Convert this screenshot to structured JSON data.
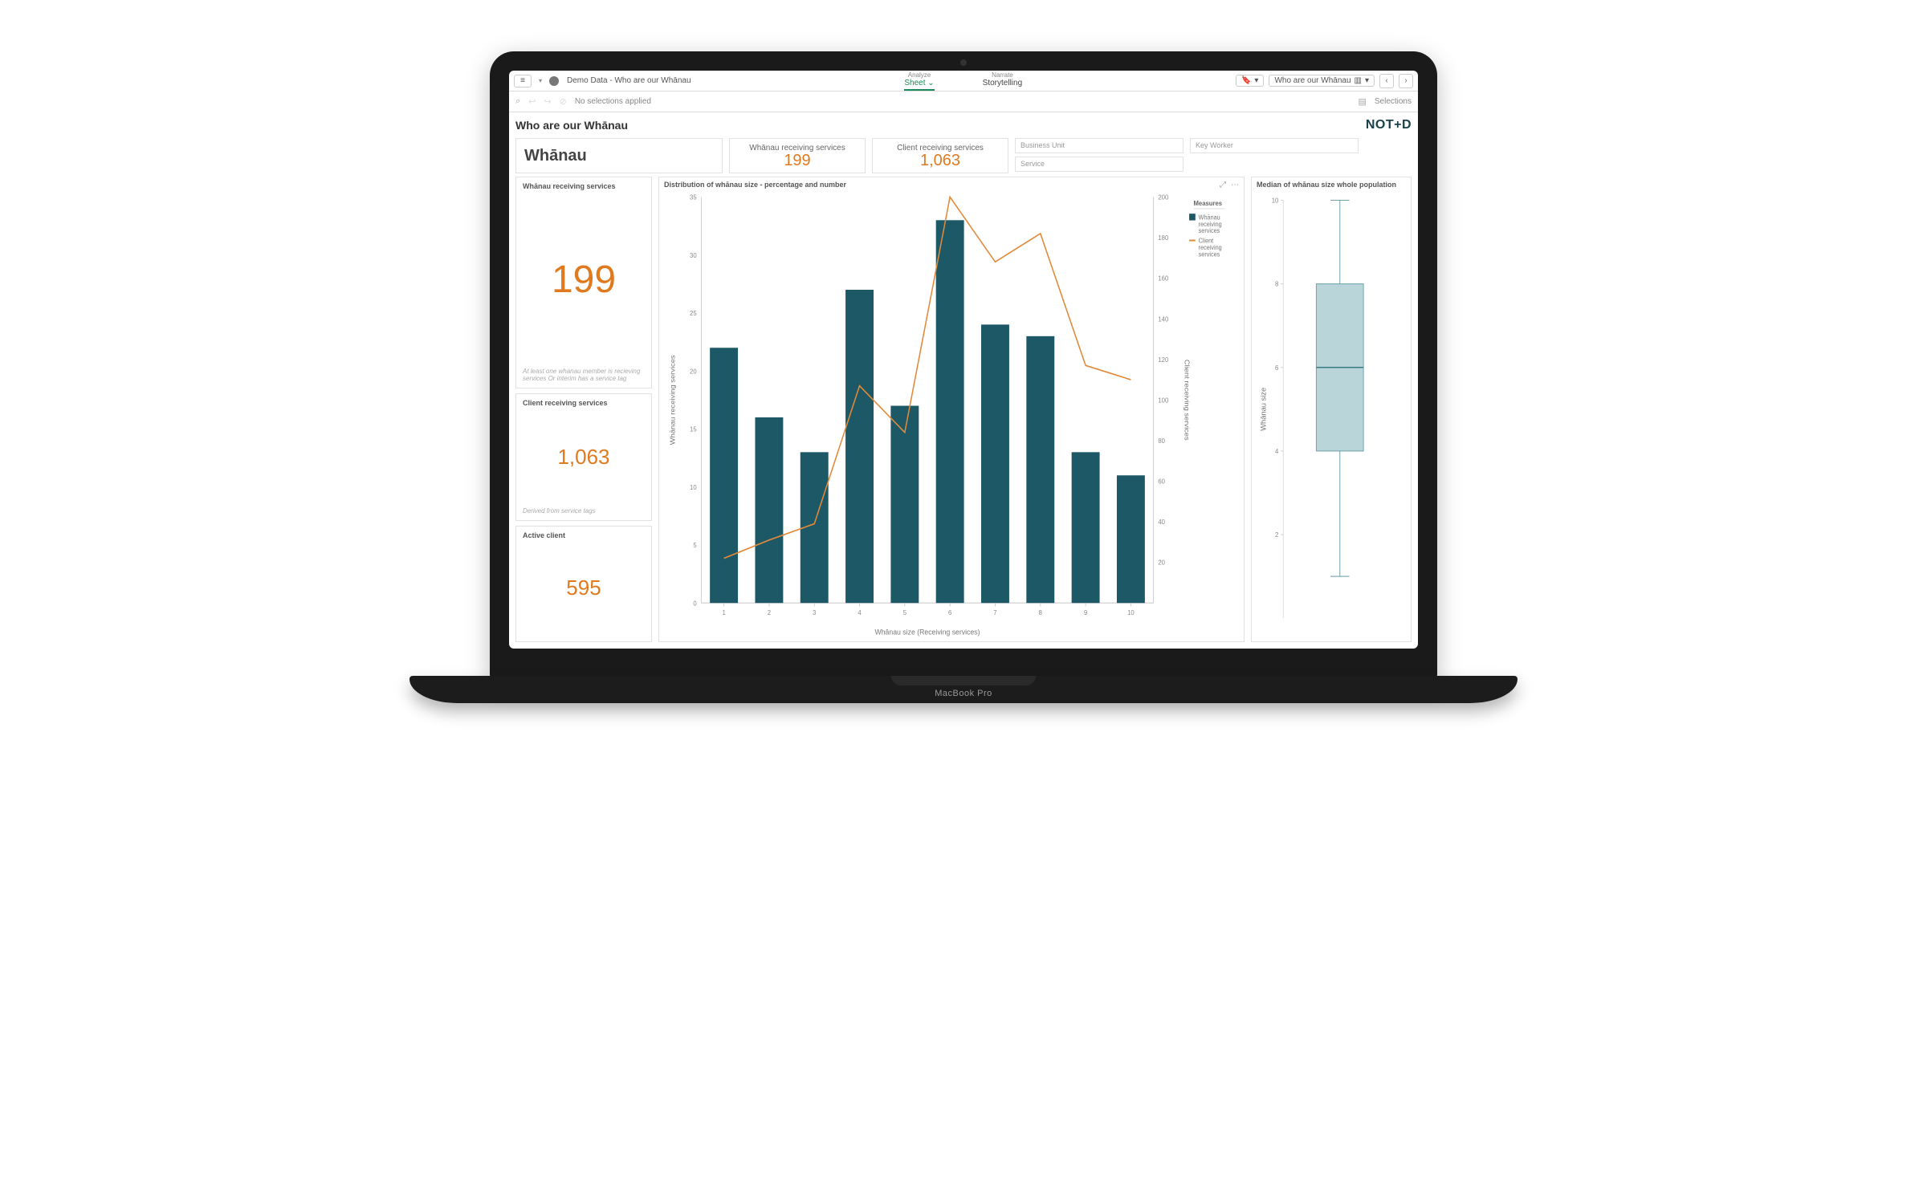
{
  "app_title": "Demo Data - Who are our Whānau",
  "nav_tabs": {
    "analyze_sub": "Analyze",
    "analyze": "Sheet",
    "narrate_sub": "Narrate",
    "narrate": "Storytelling"
  },
  "sheet_dropdown": "Who are our Whānau",
  "selections_bar": {
    "no_selections": "No selections applied",
    "selections_label": "Selections"
  },
  "page_title": "Who are our Whānau",
  "brand": "NOTED",
  "heading": "Whānau",
  "kpi_top": {
    "whanau_label": "Whānau receiving services",
    "whanau_value": "199",
    "client_label": "Client receiving services",
    "client_value": "1,063"
  },
  "filters": {
    "business_unit": "Business Unit",
    "key_worker": "Key Worker",
    "service": "Service"
  },
  "left_panels": {
    "p1_title": "Whānau receiving services",
    "p1_value": "199",
    "p1_note": "At least one whanau member is recieving services Or interim has a service tag",
    "p2_title": "Client receiving services",
    "p2_value": "1,063",
    "p2_note": "Derived from service tags",
    "p3_title": "Active client",
    "p3_value": "595"
  },
  "main_chart_title": "Distribution of whānau size - percentage and number",
  "box_chart_title": "Median of whānau size whole population",
  "legend": {
    "title": "Measures",
    "bar": "Whānau receiving services",
    "line": "Client receiving services"
  },
  "chart_data": [
    {
      "type": "bar",
      "title": "Distribution of whānau size - percentage and number",
      "xlabel": "Whānau size (Receiving services)",
      "ylabel_left": "Whānau receiving services",
      "ylabel_right": "Client receiving services",
      "categories": [
        "1",
        "2",
        "3",
        "4",
        "5",
        "6",
        "7",
        "8",
        "9",
        "10"
      ],
      "ylim_left": [
        0,
        35
      ],
      "ylim_right": [
        0,
        200
      ],
      "series": [
        {
          "name": "Whānau receiving services",
          "axis": "left",
          "type": "bar",
          "color": "#1c5866",
          "values": [
            22,
            16,
            13,
            27,
            17,
            33,
            24,
            23,
            13,
            11
          ]
        },
        {
          "name": "Client receiving services",
          "axis": "right",
          "type": "line",
          "color": "#e08a3a",
          "values": [
            22,
            31,
            39,
            107,
            84,
            200,
            168,
            182,
            117,
            110
          ]
        }
      ],
      "yticks_left": [
        0,
        5,
        10,
        15,
        20,
        25,
        30,
        35
      ],
      "yticks_right": [
        20,
        40,
        60,
        80,
        100,
        120,
        140,
        160,
        180,
        200
      ]
    },
    {
      "type": "boxplot",
      "title": "Median of whānau size whole population",
      "ylabel": "Whānau size",
      "ylim": [
        0,
        10
      ],
      "yticks": [
        2,
        4,
        6,
        8,
        10
      ],
      "data": {
        "min": 1,
        "q1": 4,
        "median": 6,
        "q3": 8,
        "max": 10
      },
      "color": "#b9d5d9"
    }
  ],
  "macbook_label": "MacBook Pro"
}
